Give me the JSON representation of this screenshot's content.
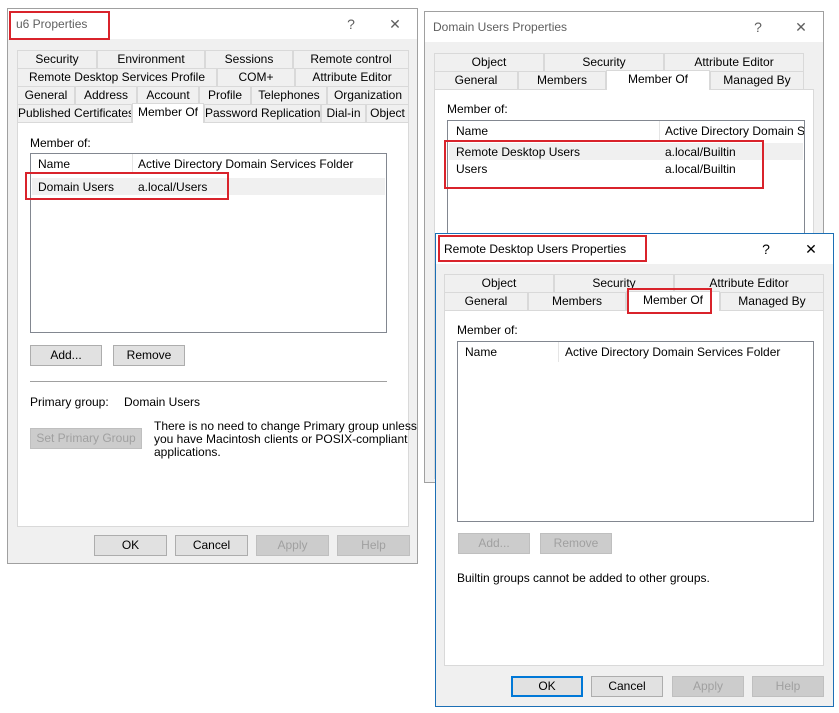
{
  "u6": {
    "title": "u6 Properties",
    "help": "?",
    "close": "✕",
    "tabs_row1": [
      "Security",
      "Environment",
      "Sessions",
      "Remote control"
    ],
    "tabs_row2": [
      "Remote Desktop Services Profile",
      "COM+",
      "Attribute Editor"
    ],
    "tabs_row3": [
      "General",
      "Address",
      "Account",
      "Profile",
      "Telephones",
      "Organization"
    ],
    "tabs_row4": [
      "Published Certificates",
      "Member Of",
      "Password Replication",
      "Dial-in",
      "Object"
    ],
    "member_of_label": "Member of:",
    "col_name": "Name",
    "col_folder": "Active Directory Domain Services Folder",
    "rows": [
      {
        "name": "Domain Users",
        "folder": "a.local/Users"
      }
    ],
    "add": "Add...",
    "remove": "Remove",
    "primary_group_label": "Primary group:",
    "primary_group_value": "Domain Users",
    "set_primary": "Set Primary Group",
    "note": [
      "There is no need to change Primary group unless",
      "you have Macintosh clients or POSIX-compliant",
      "applications."
    ],
    "ok": "OK",
    "cancel": "Cancel",
    "apply": "Apply",
    "helpbtn": "Help"
  },
  "du": {
    "title": "Domain Users Properties",
    "help": "?",
    "close": "✕",
    "tabs_row1": [
      "Object",
      "Security",
      "Attribute Editor"
    ],
    "tabs_row2": [
      "General",
      "Members",
      "Member Of",
      "Managed By"
    ],
    "member_of_label": "Member of:",
    "col_name": "Name",
    "col_folder": "Active Directory Domain Serv",
    "rows": [
      {
        "name": "Remote Desktop Users",
        "folder": "a.local/Builtin"
      },
      {
        "name": "Users",
        "folder": "a.local/Builtin"
      }
    ]
  },
  "rdu": {
    "title": "Remote Desktop Users Properties",
    "help": "?",
    "close": "✕",
    "tabs_row1": [
      "Object",
      "Security",
      "Attribute Editor"
    ],
    "tabs_row2": [
      "General",
      "Members",
      "Member Of",
      "Managed By"
    ],
    "member_of_label": "Member of:",
    "col_name": "Name",
    "col_folder": "Active Directory Domain Services Folder",
    "add": "Add...",
    "remove": "Remove",
    "note": "Builtin groups cannot be added to other groups.",
    "ok": "OK",
    "cancel": "Cancel",
    "apply": "Apply",
    "helpbtn": "Help"
  },
  "colors": {
    "highlight": "#d9232b",
    "accent": "#0078d7"
  }
}
